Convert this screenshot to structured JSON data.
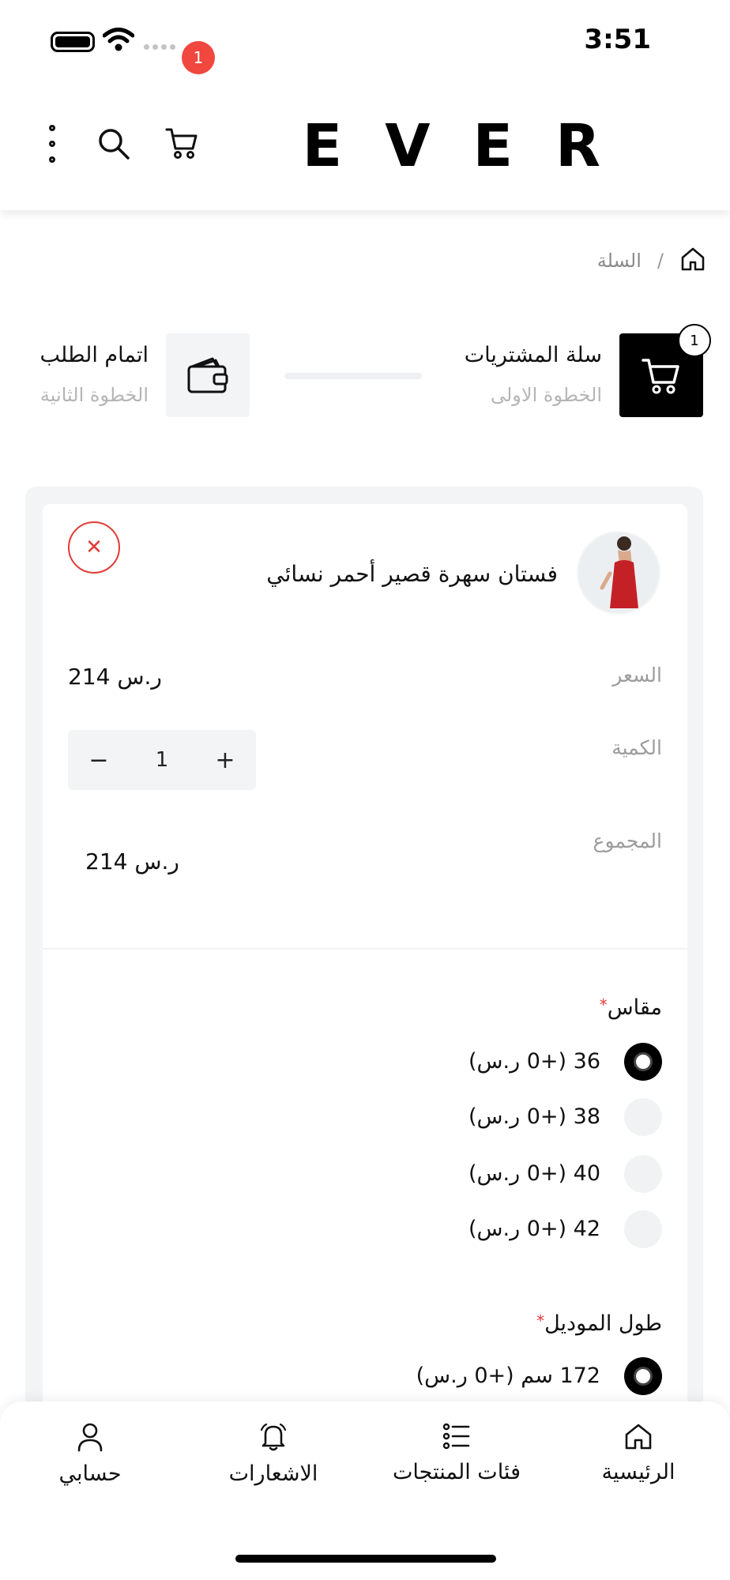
{
  "status_bar": {
    "time": "3:51"
  },
  "header": {
    "brand": "EVER",
    "cart_count": "1"
  },
  "breadcrumb": {
    "current": "السلة",
    "separator": "/"
  },
  "steps": {
    "step1": {
      "title": "سلة المشتريات",
      "subtitle": "الخطوة الاولى",
      "badge": "1"
    },
    "step2": {
      "title": "اتمام الطلب",
      "subtitle": "الخطوة الثانية"
    }
  },
  "cart_item": {
    "name": "فستان سهرة قصير أحمر نسائي",
    "price_label": "السعر",
    "price": "214 ر.س",
    "quantity_label": "الكمية",
    "quantity": "1",
    "total_label": "المجموع",
    "total": "214 ر.س"
  },
  "options": {
    "size": {
      "title": "مقاس",
      "required_mark": "*",
      "choices": [
        {
          "label": "36 (+0 ر.س)",
          "selected": true
        },
        {
          "label": "38 (+0 ر.س)",
          "selected": false
        },
        {
          "label": "40 (+0 ر.س)",
          "selected": false
        },
        {
          "label": "42 (+0 ر.س)",
          "selected": false
        }
      ]
    },
    "model_height": {
      "title": "طول الموديل",
      "required_mark": "*",
      "choices": [
        {
          "label": "172 سم (+0 ر.س)",
          "selected": true
        }
      ]
    }
  },
  "bottom_nav": {
    "home": "الرئيسية",
    "categories": "فئات المنتجات",
    "notifications": "الاشعارات",
    "account": "حسابي"
  },
  "colors": {
    "accent_red": "#f0473e",
    "black": "#000000",
    "muted_bg": "#f3f4f6"
  }
}
